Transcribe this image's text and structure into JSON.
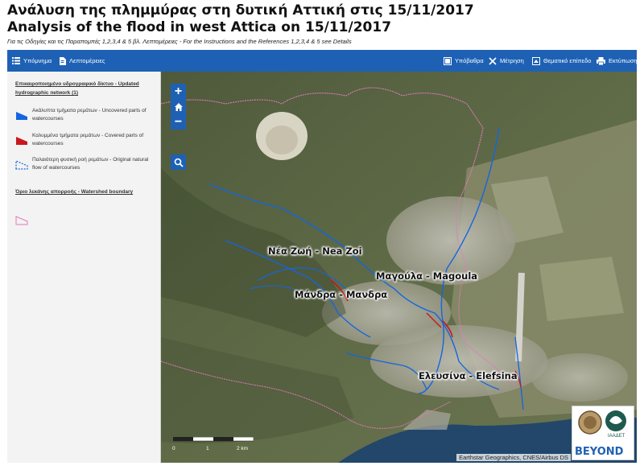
{
  "header": {
    "title_gr": "Ανάλυση της πλημμύρας στη δυτική Αττική στις 15/11/2017",
    "title_en": "Analysis of the flood in west Attica on 15/11/2017",
    "subtitle": "Για τις Οδηγίες και τις Παραπομπές 1,2,3,4 & 5 βλ. Λεπτομέρειες - For the Instructions and the References 1,2,3,4 & 5 see Details"
  },
  "toolbar": {
    "legend_label": "Υπόμνημα",
    "details_label": "Λεπτομέρειες",
    "basemap_label": "Υπόβαθρα",
    "measure_label": "Μέτρηση",
    "layer_label": "Θεματικό επίπεδο",
    "print_label": "Εκτύπωση",
    "color": "#1e61b4"
  },
  "legend": {
    "group1_title": "Επικαιροποιημένο υδρογραφικό δίκτυο - Updated hydrographic network (1)",
    "items": [
      {
        "text": "Ακάλυπτα τμήματα ρεμάτων - Uncovered parts of watercourses",
        "color": "#1565e0"
      },
      {
        "text": "Καλυμμένα τμήματα ρεμάτων - Covered parts of watercourses",
        "color": "#c8181e"
      },
      {
        "text": "Παλαιότερη φυσική ροή ρεμάτων - Original natural flow of watercourses",
        "color": "#1565e0"
      }
    ],
    "group2_title": "Όριο λεκάνης απορροής - Watershed boundary",
    "watershed_color": "#e07ab8"
  },
  "map": {
    "zoom_in": "+",
    "zoom_out": "−",
    "places": [
      {
        "label": "Νέα Ζωή - Nea Zoi"
      },
      {
        "label": "Μαγούλα - Magoula"
      },
      {
        "label": "Μάνδρα - Μανδρα"
      },
      {
        "label": "Ελευσίνα - Elefsina"
      }
    ],
    "scale_labels": [
      "0",
      "1",
      "2 km"
    ],
    "attribution": "Earthstar Geographics, CNES/Airbus DS",
    "logo_text": "BEYOND",
    "logo_org": "ΙΑΑΔΕΤ"
  }
}
